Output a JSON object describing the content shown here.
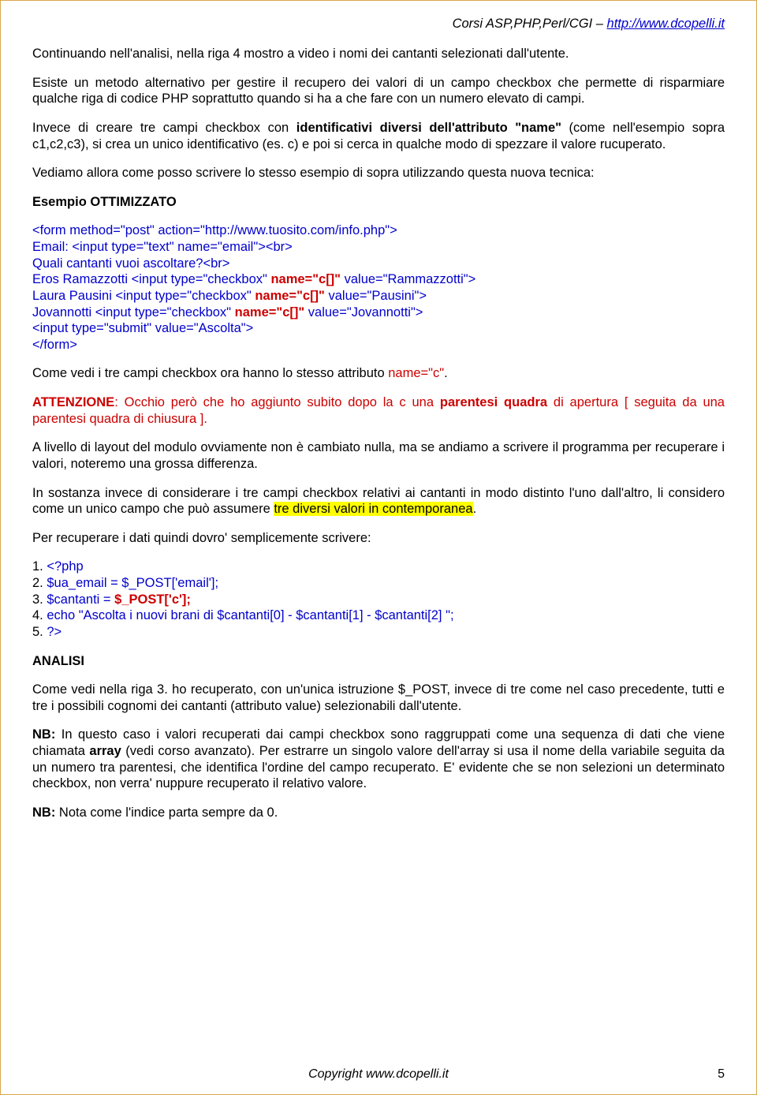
{
  "header": {
    "prefix": "Corsi ASP,PHP,Perl/CGI – ",
    "link": "http://www.dcopelli.it"
  },
  "p1": "Continuando nell'analisi, nella riga 4 mostro a video i nomi dei cantanti selezionati dall'utente.",
  "p2": "Esiste un metodo alternativo per gestire il recupero dei valori di un campo checkbox che permette di risparmiare qualche riga di codice PHP soprattutto quando si ha a che fare con un numero elevato di campi.",
  "p3a": "Invece di creare tre campi checkbox con ",
  "p3b": "identificativi diversi dell'attributo \"name\"",
  "p3c": " (come nell'esempio sopra c1,c2,c3), si crea un unico identificativo (es. c) e poi si cerca in qualche modo di spezzare il valore rucuperato.",
  "p4": "Vediamo allora come posso scrivere lo stesso esempio di sopra utilizzando questa nuova tecnica:",
  "h1": "Esempio OTTIMIZZATO",
  "code": {
    "l1": "<form method=\"post\" action=\"http://www.tuosito.com/info.php\">",
    "l2": "Email: <input type=\"text\" name=\"email\"><br>",
    "l3": "Quali cantanti vuoi ascoltare?<br>",
    "l4a": "Eros Ramazzotti <input type=\"checkbox\" ",
    "l4b": "name=\"c[]\"",
    "l4c": " value=\"Rammazzotti\">",
    "l5a": "Laura Pausini <input type=\"checkbox\" ",
    "l5b": "name=\"c[]\"",
    "l5c": " value=\"Pausini\">",
    "l6a": "Jovannotti <input type=\"checkbox\" ",
    "l6b": "name=\"c[]\"",
    "l6c": " value=\"Jovannotti\">",
    "l7": "<input type=\"submit\" value=\"Ascolta\">",
    "l8": "</form>"
  },
  "p5a": "Come vedi i tre campi checkbox ora hanno lo stesso attributo ",
  "p5b": "name=\"c\"",
  "p5c": ".",
  "p6a": "ATTENZIONE",
  "p6b": ": Occhio però che ho aggiunto subito dopo la c una ",
  "p6c": "parentesi quadra",
  "p6d": " di apertura [ seguita da una parentesi quadra di chiusura ].",
  "p7": "A livello di layout del modulo ovviamente non è cambiato nulla, ma se andiamo a scrivere il programma per recuperare i valori, noteremo una grossa differenza.",
  "p8a": "In sostanza invece di considerare i tre campi checkbox relativi ai cantanti in modo distinto l'uno dall'altro, li considero come un unico campo che può assumere ",
  "p8b": "tre diversi valori in contemporanea",
  "p8c": ".",
  "p9": "Per recuperare i dati quindi dovro' semplicemente scrivere:",
  "snippet": {
    "s1a": "1. ",
    "s1b": "<?php",
    "s2a": "2. ",
    "s2b": "$ua_email = $_POST['email'];",
    "s3a": "3. ",
    "s3b": "$cantanti = ",
    "s3c": "$_POST['c'];",
    "s4a": "4. ",
    "s4b": "echo \"Ascolta i nuovi brani di  $cantanti[0]  -  $cantanti[1]  -  $cantanti[2]  \";",
    "s5a": "5. ",
    "s5b": "?>"
  },
  "h2": "ANALISI",
  "p10": "Come vedi nella riga 3. ho recuperato, con un'unica istruzione $_POST, invece di tre come nel caso precedente, tutti e tre i possibili cognomi dei cantanti (attributo value) selezionabili dall'utente.",
  "p11a": "NB:",
  "p11b": " In questo caso i valori recuperati dai campi checkbox sono raggruppati come una sequenza di dati che viene chiamata ",
  "p11c": "array",
  "p11d": " (vedi corso avanzato). Per estrarre un singolo valore dell'array si usa il nome della variabile seguita da un numero tra parentesi, che identifica l'ordine del campo recuperato. E' evidente che se non selezioni un determinato checkbox, non verra' nuppure recuperato il relativo valore.",
  "p12a": "NB:",
  "p12b": " Nota come l'indice parta sempre da 0.",
  "footer": {
    "text": "Copyright www.dcopelli.it",
    "page": "5"
  }
}
